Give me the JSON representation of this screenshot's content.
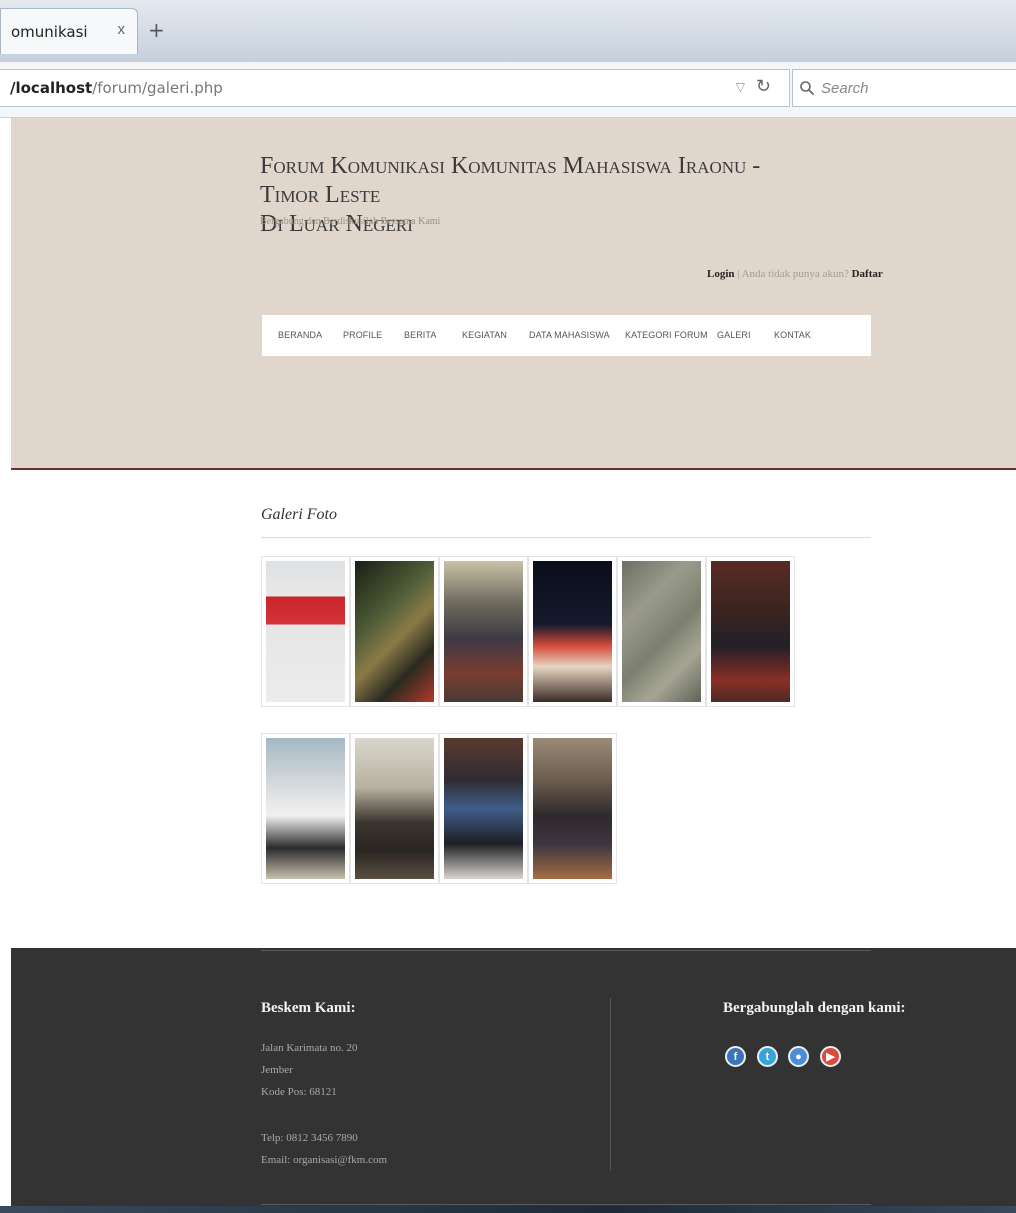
{
  "browser": {
    "tab_title": "omunikasi",
    "tab_close": "x",
    "new_tab": "+",
    "url_host": "/localhost",
    "url_path": "/forum/galeri.php",
    "search_placeholder": "Search"
  },
  "header": {
    "title_line1": "Forum Komunikasi Komunitas Mahasiswa Iraonu - Timor Leste",
    "title_line2": "Di Luar Negeri",
    "tagline": "Bergabung dan Berdiskusilah Bersama Kami",
    "login": "Login",
    "auth_sep": " | Anda tidak punya akun? ",
    "register": "Daftar"
  },
  "menu": [
    "BERANDA",
    "PROFILE",
    "BERITA",
    "KEGIATAN",
    "DATA MAHASISWA",
    "KATEGORI FORUM",
    "GALERI",
    "KONTAK"
  ],
  "gallery": {
    "title": "Galeri Foto"
  },
  "footer": {
    "base_title": "Beskem Kami:",
    "address": [
      "Jalan Karimata no. 20",
      "Jember",
      "Kode Pos: 68121"
    ],
    "phone": "Telp: 0812 3456 7890",
    "email": "Email: organisasi@fkm.com",
    "join_title": "Bergabunglah dengan kami:",
    "social": [
      {
        "icon": "facebook-icon",
        "color": "#3b74b9"
      },
      {
        "icon": "twitter-icon",
        "color": "#38a4d8"
      },
      {
        "icon": "flickr-icon",
        "color": "#4a8fd6"
      },
      {
        "icon": "youtube-icon",
        "color": "#d94b3c"
      }
    ]
  },
  "colors": {
    "header_bg": "#e0d6cc",
    "header_border": "#6f2f35",
    "footer_bg": "#333333"
  }
}
